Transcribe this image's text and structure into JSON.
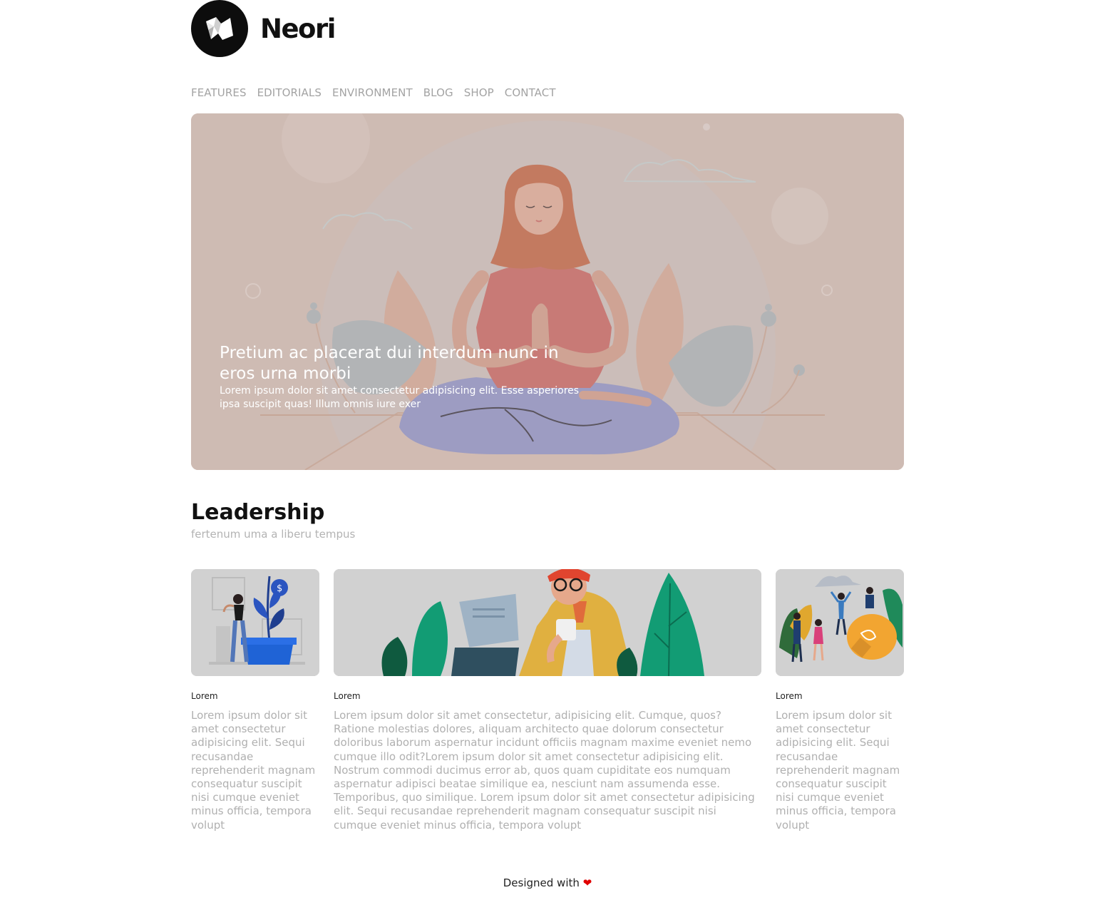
{
  "brand": {
    "name": "Neori"
  },
  "nav": {
    "items": [
      "FEATURES",
      "EDITORIALS",
      "ENVIRONMENT",
      "BLOG",
      "SHOP",
      "CONTACT"
    ]
  },
  "hero": {
    "title": "Pretium ac placerat dui interdum nunc in eros urna morbi",
    "subtitle": "Lorem ipsum dolor sit amet consectetur adipisicing elit. Esse asperiores ipsa suscipit quas! Illum omnis iure exer"
  },
  "section": {
    "title": "Leadership",
    "subtitle": "fertenum uma a liberu tempus"
  },
  "cards": [
    {
      "label": "Lorem",
      "text": "Lorem ipsum dolor sit amet consectetur adipisicing elit. Sequi recusandae reprehenderit magnam consequatur suscipit nisi cumque eveniet minus officia, tempora volupt"
    },
    {
      "label": "Lorem",
      "text": "Lorem ipsum dolor sit amet consectetur, adipisicing elit. Cumque, quos? Ratione molestias dolores, aliquam architecto quae dolorum consectetur doloribus laborum aspernatur incidunt officiis magnam maxime eveniet nemo cumque illo odit?Lorem ipsum dolor sit amet consectetur adipisicing elit. Nostrum commodi ducimus error ab, quos quam cupiditate eos numquam aspernatur adipisci beatae similique ea, nesciunt nam assumenda esse. Temporibus, quo similique. Lorem ipsum dolor sit amet consectetur adipisicing elit. Sequi recusandae reprehenderit magnam consequatur suscipit nisi cumque eveniet minus officia, tempora volupt"
    },
    {
      "label": "Lorem",
      "text": "Lorem ipsum dolor sit amet consectetur adipisicing elit. Sequi recusandae reprehenderit magnam consequatur suscipit nisi cumque eveniet minus officia, tempora volupt"
    }
  ],
  "footer": {
    "text": "Designed with",
    "heart_icon": "heart-icon",
    "heart_color": "#e00000"
  },
  "colors": {
    "hero_background": "#d3bfb6",
    "logo_background": "#0d0d0d",
    "nav_text": "#a3a3a3"
  }
}
